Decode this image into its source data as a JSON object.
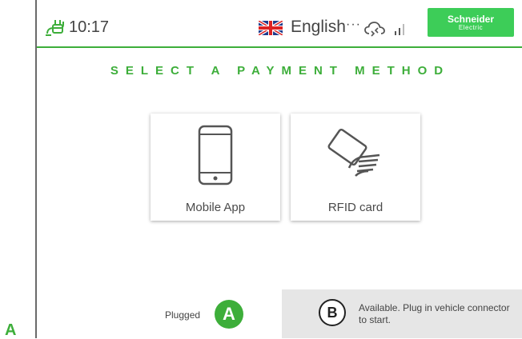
{
  "header": {
    "time": "10:17",
    "language": "English",
    "language_more": "···",
    "brand_main": "Schneider",
    "brand_sub": "Electric"
  },
  "main": {
    "title": "SELECT A PAYMENT METHOD",
    "options": [
      {
        "label": "Mobile App",
        "icon": "smartphone-icon"
      },
      {
        "label": "RFID card",
        "icon": "rfid-card-icon"
      }
    ]
  },
  "connectors": {
    "a": {
      "badge": "A",
      "status": "Plugged"
    },
    "b": {
      "badge": "B",
      "status": "Available. Plug in vehicle connector to start."
    }
  },
  "edge_label": "A",
  "colors": {
    "accent_green": "#3dae3a",
    "brand_green": "#3dcd58",
    "panel_grey": "#e6e6e6"
  }
}
